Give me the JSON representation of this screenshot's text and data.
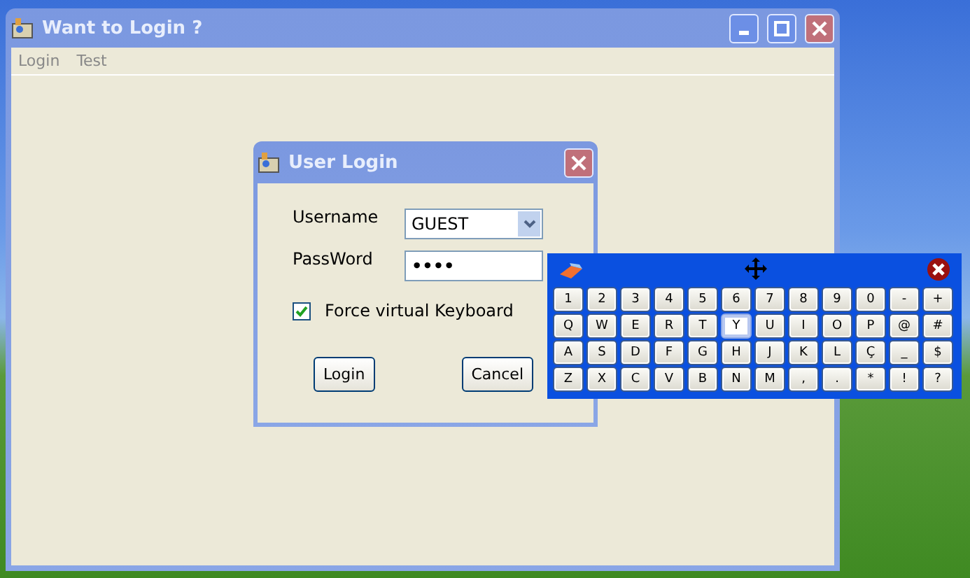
{
  "window": {
    "title": "Want to Login ?"
  },
  "menu": [
    {
      "label": "Login"
    },
    {
      "label": "Test"
    }
  ],
  "dialog": {
    "title": "User Login",
    "fields": [
      {
        "kind": "combo",
        "label": "Username",
        "value": "GUEST"
      },
      {
        "kind": "password",
        "label": "PassWord",
        "value": "••••"
      }
    ],
    "checkbox": {
      "label": "Force virtual Keyboard",
      "checked": true
    },
    "buttons": [
      "Login",
      "Cancel"
    ]
  },
  "keyboard": {
    "rows": [
      [
        {
          "label": "1",
          "highlighted": false
        },
        {
          "label": "2",
          "highlighted": false
        },
        {
          "label": "3",
          "highlighted": false
        },
        {
          "label": "4",
          "highlighted": false
        },
        {
          "label": "5",
          "highlighted": false
        },
        {
          "label": "6",
          "highlighted": false
        },
        {
          "label": "7",
          "highlighted": false
        },
        {
          "label": "8",
          "highlighted": false
        },
        {
          "label": "9",
          "highlighted": false
        },
        {
          "label": "0",
          "highlighted": false
        },
        {
          "label": "-",
          "highlighted": false
        },
        {
          "label": "+",
          "highlighted": false
        }
      ],
      [
        {
          "label": "Q",
          "highlighted": false
        },
        {
          "label": "W",
          "highlighted": false
        },
        {
          "label": "E",
          "highlighted": false
        },
        {
          "label": "R",
          "highlighted": false
        },
        {
          "label": "T",
          "highlighted": false
        },
        {
          "label": "Y",
          "highlighted": true
        },
        {
          "label": "U",
          "highlighted": false
        },
        {
          "label": "I",
          "highlighted": false
        },
        {
          "label": "O",
          "highlighted": false
        },
        {
          "label": "P",
          "highlighted": false
        },
        {
          "label": "@",
          "highlighted": false
        },
        {
          "label": "#",
          "highlighted": false
        }
      ],
      [
        {
          "label": "A",
          "highlighted": false
        },
        {
          "label": "S",
          "highlighted": false
        },
        {
          "label": "D",
          "highlighted": false
        },
        {
          "label": "F",
          "highlighted": false
        },
        {
          "label": "G",
          "highlighted": false
        },
        {
          "label": "H",
          "highlighted": false
        },
        {
          "label": "J",
          "highlighted": false
        },
        {
          "label": "K",
          "highlighted": false
        },
        {
          "label": "L",
          "highlighted": false
        },
        {
          "label": "Ç",
          "highlighted": false
        },
        {
          "label": "_",
          "highlighted": false
        },
        {
          "label": "$",
          "highlighted": false
        }
      ],
      [
        {
          "label": "Z",
          "highlighted": false
        },
        {
          "label": "X",
          "highlighted": false
        },
        {
          "label": "C",
          "highlighted": false
        },
        {
          "label": "V",
          "highlighted": false
        },
        {
          "label": "B",
          "highlighted": false
        },
        {
          "label": "N",
          "highlighted": false
        },
        {
          "label": "M",
          "highlighted": false
        },
        {
          "label": ",",
          "highlighted": false
        },
        {
          "label": ".",
          "highlighted": false
        },
        {
          "label": "*",
          "highlighted": false
        },
        {
          "label": "!",
          "highlighted": false
        },
        {
          "label": "?",
          "highlighted": false
        }
      ]
    ]
  }
}
